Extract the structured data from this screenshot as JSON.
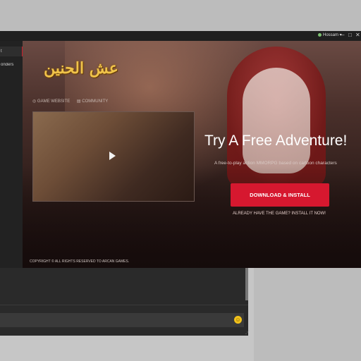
{
  "titlebar": {
    "user_name": "Hossam ▾",
    "minimize": "–",
    "maximize": "□",
    "close": "✕"
  },
  "sidebar": {
    "items": [
      {
        "label": "t"
      },
      {
        "label": "onders"
      }
    ]
  },
  "hero": {
    "logo_text": "عش الحنين",
    "links": {
      "game_website": "◎ GAME WEBSITE",
      "community": "▤ COMMUNITY"
    },
    "headline": "Try A Free Adventure!",
    "subtext": "A free-to-play action MMORPG based on cartoon characters",
    "download_button": "DOWNLOAD & INSTALL",
    "already_have": "ALREADY HAVE THE GAME? INSTALL IT NOW!",
    "copyright": "COPYRIGHT © ALL RIGHTS RESERVED TO ARCAN GAMES."
  },
  "chat": {
    "emoji": "☺",
    "resize_grip": "⋰"
  },
  "colors": {
    "accent_red": "#d6182f",
    "logo_gold": "#f0c34a",
    "app_bg": "#1b1b1b"
  },
  "icons": [
    "user-avatar-icon",
    "play-icon",
    "emoji-icon",
    "globe-icon",
    "community-icon"
  ]
}
